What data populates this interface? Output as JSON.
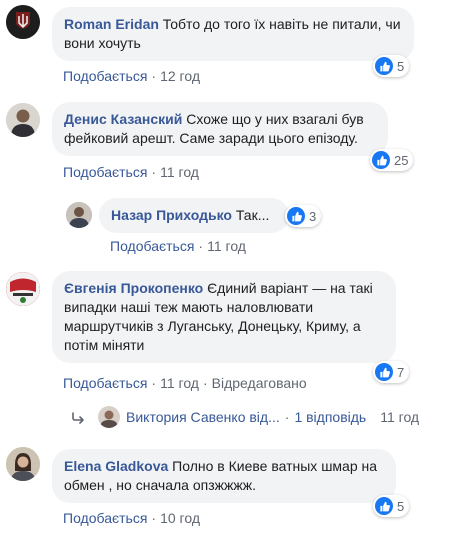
{
  "comments": [
    {
      "author": "Roman Eridan",
      "text": "Тобто до того їх навіть не питали, чи вони хочуть",
      "reactions": "5",
      "like_label": "Подобається",
      "time": "12 год"
    },
    {
      "author": "Денис Казанский",
      "text": "Схоже що у них взагалі був фейковий арешт. Саме заради цього епізоду.",
      "reactions": "25",
      "like_label": "Подобається",
      "time": "11 год"
    },
    {
      "author": "Назар Приходько",
      "text": "Так...",
      "reactions": "3",
      "like_label": "Подобається",
      "time": "11 год"
    },
    {
      "author": "Євгенія Прокопенко",
      "text": "Єдиний варіант — на такі випадки наші теж мають наловлювати маршрутчиків з Луганську, Донецьку, Криму, а потім міняти",
      "reactions": "7",
      "like_label": "Подобається",
      "time": "11 год",
      "edited": "Відредаговано"
    },
    {
      "author": "Elena Gladkova",
      "text": "Полно в Киеве ватных шмар на обмен , но сначала опзжжжж.",
      "reactions": "5",
      "like_label": "Подобається",
      "time": "10 год"
    }
  ],
  "reply_summary": {
    "author": "Виктория Савенко від...",
    "count": "1 відповідь",
    "time": "11 год"
  },
  "colors": {
    "author": "#385898",
    "bubble": "#f2f3f5",
    "meta": "#606770",
    "like_blue": "#1877f2"
  }
}
